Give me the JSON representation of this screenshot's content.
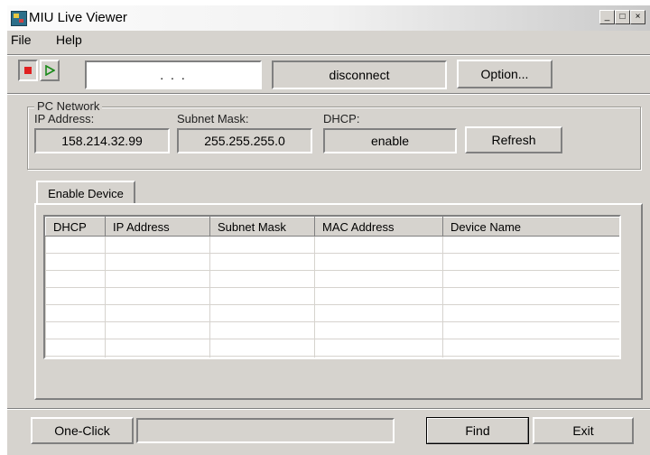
{
  "window": {
    "title": "MIU Live Viewer",
    "controls": [
      "_",
      "□",
      "×"
    ]
  },
  "menu": {
    "file": "File",
    "help": "Help"
  },
  "toolbar": {
    "address_value": ".   .   .",
    "connection_status": "disconnect",
    "option_label": "Option...",
    "stop_color": "#e02020",
    "play_color": "#1a8a1a"
  },
  "pc_network": {
    "title": "PC Network",
    "ip_label": "IP Address:",
    "ip_value": "158.214.32.99",
    "subnet_label": "Subnet Mask:",
    "subnet_value": "255.255.255.0",
    "dhcp_label": "DHCP:",
    "dhcp_value": "enable",
    "refresh_label": "Refresh"
  },
  "tab": {
    "label": "Enable Device"
  },
  "device_table": {
    "columns": [
      "DHCP",
      "IP Address",
      "Subnet Mask",
      "MAC Address",
      "Device Name"
    ],
    "rows": []
  },
  "footer": {
    "one_click_label": "One-Click",
    "status_text": "",
    "find_label": "Find",
    "exit_label": "Exit"
  }
}
